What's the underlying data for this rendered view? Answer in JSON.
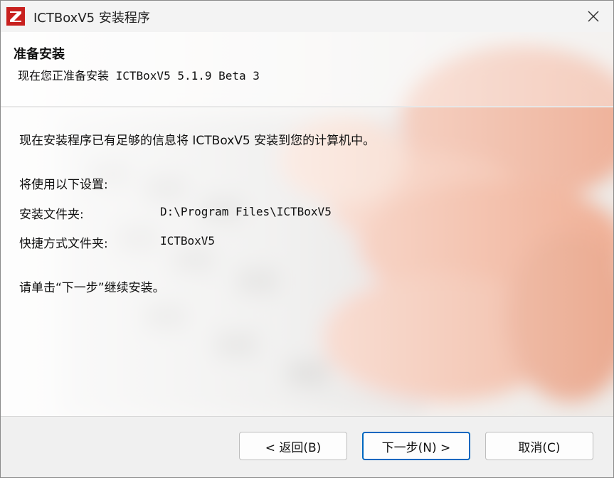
{
  "window": {
    "title": "ICTBoxV5 安装程序"
  },
  "header": {
    "title": "准备安装",
    "subtitle": "现在您正准备安装 ICTBoxV5 5.1.9 Beta 3"
  },
  "content": {
    "intro": "现在安装程序已有足够的信息将 ICTBoxV5 安装到您的计算机中。",
    "settings_heading": "将使用以下设置:",
    "install_folder_label": "安装文件夹:",
    "install_folder_value": "D:\\Program Files\\ICTBoxV5",
    "shortcut_folder_label": "快捷方式文件夹:",
    "shortcut_folder_value": "ICTBoxV5",
    "instruction": "请单击“下一步”继续安装。"
  },
  "buttons": {
    "back": "< 返回(B)",
    "next": "下一步(N) >",
    "cancel": "取消(C)"
  },
  "colors": {
    "icon_red": "#c8201e",
    "focus_blue": "#0067c0"
  },
  "icons": {
    "app": "ictbox-logo-icon",
    "close": "close-icon"
  }
}
